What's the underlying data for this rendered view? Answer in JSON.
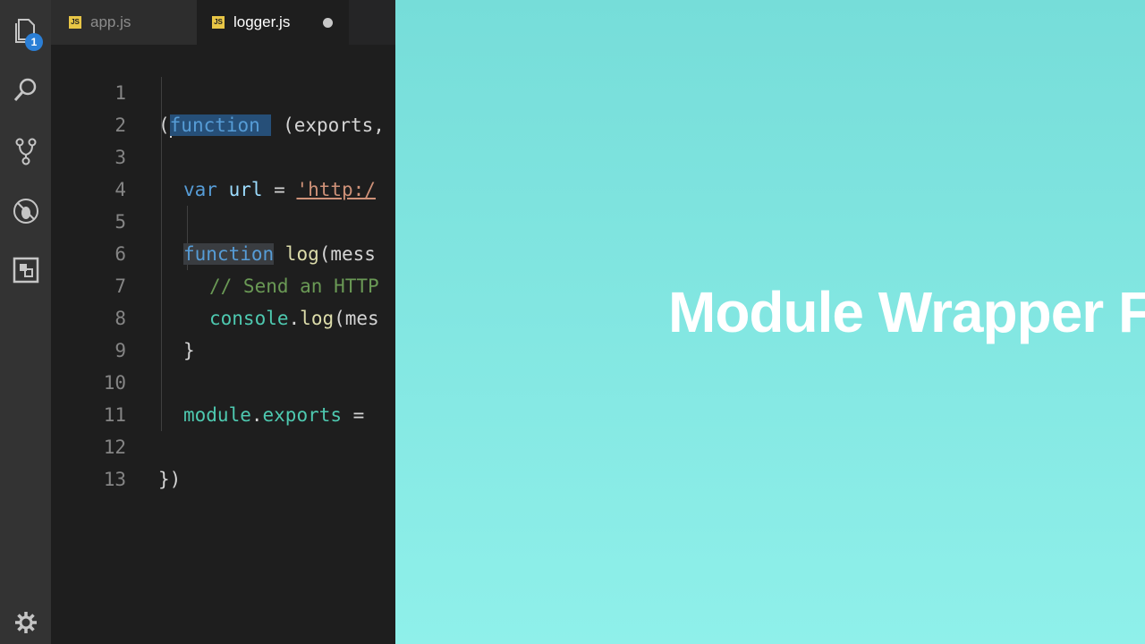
{
  "activity_bar": {
    "explorer_badge": "1",
    "icons": [
      "files-icon",
      "search-icon",
      "source-control-icon",
      "debug-icon",
      "extensions-icon",
      "gear-icon"
    ]
  },
  "tabs": [
    {
      "label": "app.js",
      "icon_text": "JS",
      "active": false
    },
    {
      "label": "logger.js",
      "icon_text": "JS",
      "active": true,
      "dirty": true
    }
  ],
  "code_lines": [
    {
      "num": "1"
    },
    {
      "num": "2"
    },
    {
      "num": "3"
    },
    {
      "num": "4"
    },
    {
      "num": "5"
    },
    {
      "num": "6"
    },
    {
      "num": "7"
    },
    {
      "num": "8"
    },
    {
      "num": "9"
    },
    {
      "num": "10"
    },
    {
      "num": "11"
    },
    {
      "num": "12"
    },
    {
      "num": "13"
    }
  ],
  "code": {
    "l1": {
      "open": "(",
      "kw": "function",
      "rest": " (exports,"
    },
    "l3": {
      "kw": "var",
      "name": " url",
      "eq": " = ",
      "str": "'http:/"
    },
    "l5": {
      "kw": "function",
      "fn": " log",
      "rest": "(mess"
    },
    "l6": {
      "comment": "// Send an HTTP"
    },
    "l7": {
      "obj": "console",
      "dot": ".",
      "fn": "log",
      "rest": "(mes"
    },
    "l8": {
      "brace": "}"
    },
    "l10": {
      "mod": "module",
      "dot": ".",
      "prop": "exports",
      "eq": " ="
    },
    "l12": {
      "close": "})"
    }
  },
  "slide": {
    "title": "Module Wrapper F",
    "colors": {
      "top": "#76ddd9",
      "bottom": "#8ff0ea"
    }
  }
}
